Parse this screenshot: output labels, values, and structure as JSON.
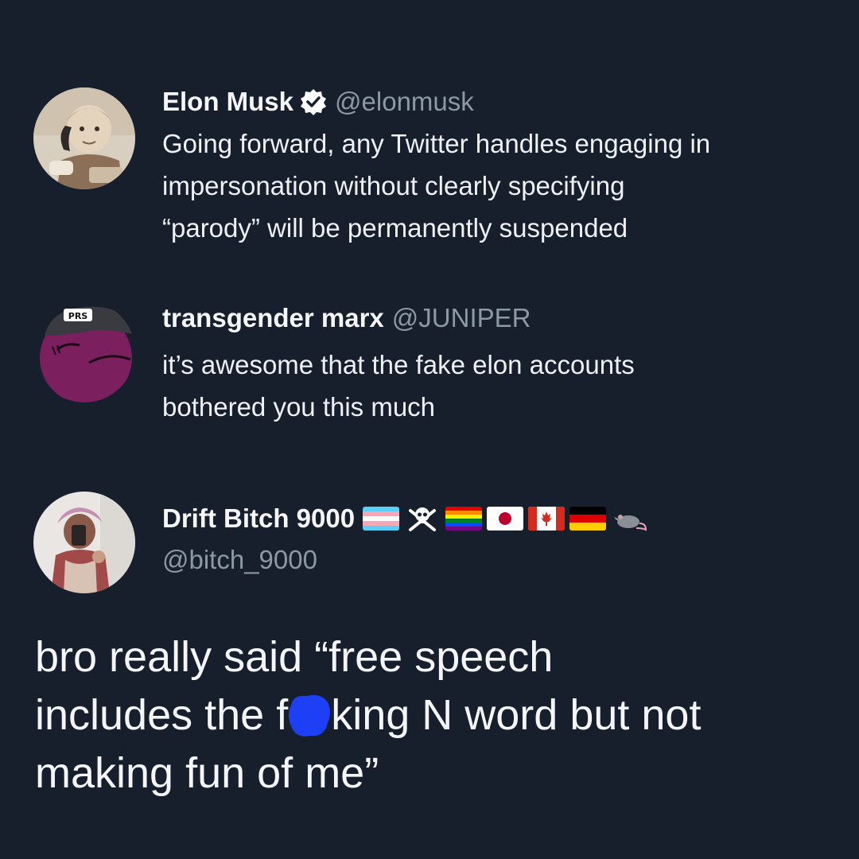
{
  "tweets": [
    {
      "name": "Elon Musk",
      "handle": "@elonmusk",
      "verified": true,
      "text_lines": [
        "Going forward, any Twitter handles engaging in",
        "impersonation without clearly specifying",
        "“parody” will be permanently suspended"
      ]
    },
    {
      "name": "transgender marx",
      "handle": "@JUNIPER",
      "avatar_hat_text": "PRS",
      "text_lines": [
        "it’s awesome that the fake elon accounts",
        "bothered you this much"
      ]
    },
    {
      "name": "Drift Bitch 9000",
      "handle": "@bitch_9000",
      "name_emoji": [
        "transgender-flag",
        "skull-and-crossbones",
        "rainbow-flag",
        "japan-flag",
        "canada-flag",
        "germany-flag",
        "rat"
      ]
    }
  ],
  "caption": {
    "line1": "bro really said “free speech",
    "line2_before": "includes the f",
    "line2_after": "king N word but not",
    "line3": "making fun of me”"
  },
  "colors": {
    "background": "#161f2b",
    "handle": "#8b98a5",
    "verified_badge": "#ffffff",
    "censor_blob": "#1d3ff5"
  }
}
